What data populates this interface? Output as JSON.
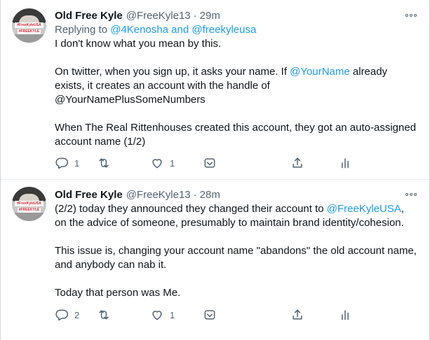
{
  "tweets": [
    {
      "name": "Old Free Kyle",
      "handle": "@FreeKyle13",
      "separator": "·",
      "time": "29m",
      "avatar_text_1": "#FreeKyleUSA",
      "avatar_text_2": "#FREEKYLE",
      "replying_prefix": "Replying to",
      "replying_to": "@4Kenosha and @freekyleusa",
      "body": {
        "p1": "I don't know what you mean by this.",
        "p2_a": "On twitter, when you sign up, it asks your name. If",
        "p2_mention": "@YourName",
        "p2_b": "already exists, it creates an account with the handle of @YourNamePlusSomeNumbers",
        "p3": "When The Real Rittenhouses created this account, they got an auto-assigned account name (1/2)"
      },
      "actions": {
        "reply_icon": "reply-icon",
        "reply_count": "1",
        "retweet_icon": "retweet-icon",
        "retweet_count": "",
        "like_icon": "heart-icon",
        "like_count": "1",
        "tip_icon": "tip-jar-icon",
        "share_icon": "share-icon",
        "analytics_icon": "analytics-icon"
      }
    },
    {
      "name": "Old Free Kyle",
      "handle": "@FreeKyle13",
      "separator": "·",
      "time": "28m",
      "avatar_text_1": "#FreeKyleUSA",
      "avatar_text_2": "#FREEKYLE",
      "body": {
        "p1_a": "(2/2) today they announced they changed their account to",
        "p1_mention": "@FreeKyleUSA",
        "p1_b": ", on the advice of someone, presumably to maintain brand identity/cohesion.",
        "p2": "This issue is, changing your account name \"abandons\" the old account name, and anybody can nab it.",
        "p3": "Today that person was Me."
      },
      "actions": {
        "reply_icon": "reply-icon",
        "reply_count": "2",
        "retweet_icon": "retweet-icon",
        "retweet_count": "",
        "like_icon": "heart-icon",
        "like_count": "1",
        "tip_icon": "tip-jar-icon",
        "share_icon": "share-icon",
        "analytics_icon": "analytics-icon"
      }
    }
  ],
  "colors": {
    "link": "#1d9bf0",
    "text": "#0f1419",
    "secondary": "#536471",
    "divider": "#e6ecf0"
  }
}
